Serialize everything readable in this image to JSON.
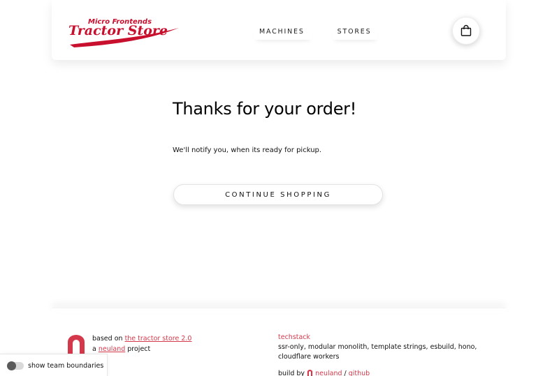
{
  "header": {
    "logo_text_top": "Micro Frontends",
    "logo_text_main": "Tractor Store",
    "nav": [
      {
        "label": "MACHINES"
      },
      {
        "label": "STORES"
      }
    ],
    "cart_icon": "shopping-bag-icon"
  },
  "main": {
    "title": "Thanks for your order!",
    "notice": "We'll notify you, when its ready for pickup.",
    "continue_label": "CONTINUE SHOPPING"
  },
  "footer": {
    "based_on_prefix": "based on ",
    "based_on_link": "the tractor store 2.0",
    "a_prefix": "a ",
    "neuland_link": "neuland",
    "project_suffix": " project",
    "techstack_heading": "techstack",
    "techstack_text": "ssr-only, modular monolith, template strings, esbuild, hono, cloudflare workers",
    "build_by_prefix": "build by ",
    "build_by_link": "neuland",
    "separator": " / ",
    "github_link": "github"
  },
  "toggle": {
    "label": "show team boundaries",
    "checked": false
  },
  "colors": {
    "accent": "#d4394b"
  }
}
